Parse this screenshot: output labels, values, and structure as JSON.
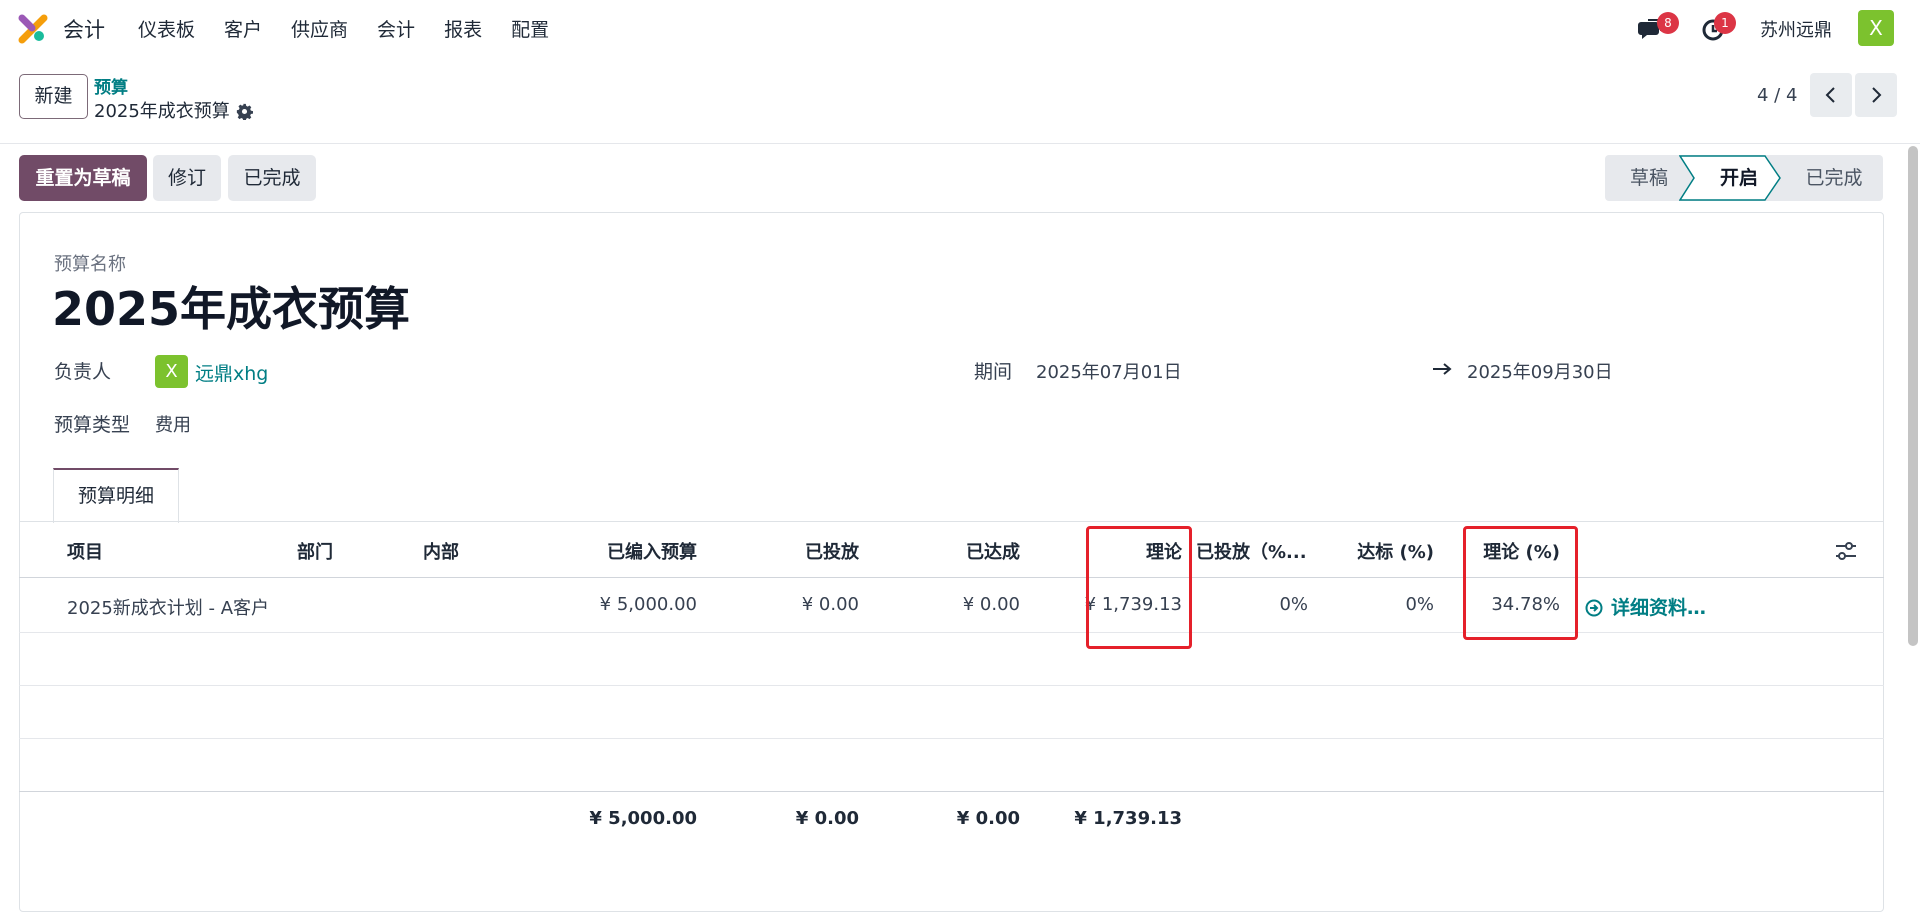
{
  "navbar": {
    "app_name": "会计",
    "menu": [
      "仪表板",
      "客户",
      "供应商",
      "会计",
      "报表",
      "配置"
    ],
    "messages_count": "8",
    "activities_count": "1",
    "company": "苏州远鼎",
    "user_initial": "X"
  },
  "control_panel": {
    "new_label": "新建",
    "breadcrumb_parent": "预算",
    "breadcrumb_current": "2025年成衣预算",
    "pager": "4 / 4"
  },
  "statusbar": {
    "buttons": [
      "重置为草稿",
      "修订",
      "已完成"
    ],
    "stages": [
      "草稿",
      "开启",
      "已完成"
    ],
    "active_stage": "开启"
  },
  "form": {
    "name_label": "预算名称",
    "name": "2025年成衣预算",
    "owner_label": "负责人",
    "owner_initial": "X",
    "owner": "远鼎xhg",
    "period_label": "期间",
    "date_from": "2025年07月01日",
    "date_to": "2025年09月30日",
    "type_label": "预算类型",
    "type": "费用"
  },
  "tab": {
    "label": "预算明细"
  },
  "table": {
    "headers": [
      "项目",
      "部门",
      "内部",
      "已编入预算",
      "已投放",
      "已达成",
      "理论",
      "已投放（%...",
      "达标 (%)",
      "理论 (%)"
    ],
    "rows": [
      {
        "project": "2025新成衣计划 - A客户",
        "department": "",
        "internal": "",
        "budgeted": "¥ 5,000.00",
        "committed": "¥ 0.00",
        "achieved": "¥ 0.00",
        "theoretical": "¥ 1,739.13",
        "committed_pct": "0%",
        "achieved_pct": "0%",
        "theoretical_pct": "34.78%",
        "detail_link": "详细资料…"
      }
    ],
    "footer": {
      "budgeted": "¥ 5,000.00",
      "committed": "¥ 0.00",
      "achieved": "¥ 0.00",
      "theoretical": "¥ 1,739.13"
    }
  },
  "colors": {
    "primary": "#714b67",
    "link": "#017e84",
    "avatar": "#7cc22e",
    "highlight": "#e5202a",
    "badge": "#dc3545"
  }
}
